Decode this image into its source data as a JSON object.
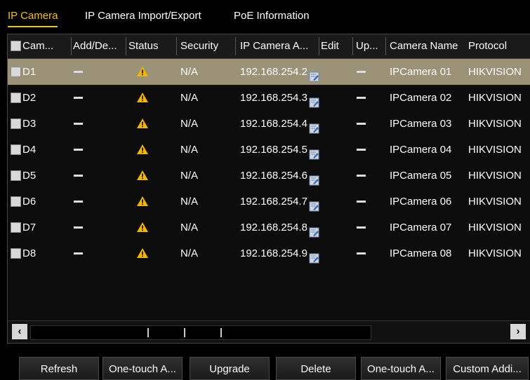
{
  "tabs": [
    "IP Camera",
    "IP Camera Import/Export",
    "PoE Information"
  ],
  "columns": [
    "Cam...",
    "Add/De...",
    "Status",
    "Security",
    "IP Camera A...",
    "Edit",
    "Up...",
    "Camera Name",
    "Protocol"
  ],
  "rows": [
    {
      "cam": "D1",
      "security": "N/A",
      "ip": "192.168.254.2",
      "name": "IPCamera 01",
      "protocol": "HIKVISION"
    },
    {
      "cam": "D2",
      "security": "N/A",
      "ip": "192.168.254.3",
      "name": "IPCamera 02",
      "protocol": "HIKVISION"
    },
    {
      "cam": "D3",
      "security": "N/A",
      "ip": "192.168.254.4",
      "name": "IPCamera 03",
      "protocol": "HIKVISION"
    },
    {
      "cam": "D4",
      "security": "N/A",
      "ip": "192.168.254.5",
      "name": "IPCamera 04",
      "protocol": "HIKVISION"
    },
    {
      "cam": "D5",
      "security": "N/A",
      "ip": "192.168.254.6",
      "name": "IPCamera 05",
      "protocol": "HIKVISION"
    },
    {
      "cam": "D6",
      "security": "N/A",
      "ip": "192.168.254.7",
      "name": "IPCamera 06",
      "protocol": "HIKVISION"
    },
    {
      "cam": "D7",
      "security": "N/A",
      "ip": "192.168.254.8",
      "name": "IPCamera 07",
      "protocol": "HIKVISION"
    },
    {
      "cam": "D8",
      "security": "N/A",
      "ip": "192.168.254.9",
      "name": "IPCamera 08",
      "protocol": "HIKVISION"
    }
  ],
  "scroll": {
    "left": "‹",
    "right": "›"
  },
  "buttons": [
    "Refresh",
    "One-touch A...",
    "Upgrade",
    "Delete",
    "One-touch A...",
    "Custom Addi..."
  ],
  "icons": {
    "status": "warning-icon",
    "edit": "edit-icon"
  },
  "colors": {
    "accent": "#f2c400",
    "selected_row": "#9b9278",
    "warning": "#f2b600"
  }
}
